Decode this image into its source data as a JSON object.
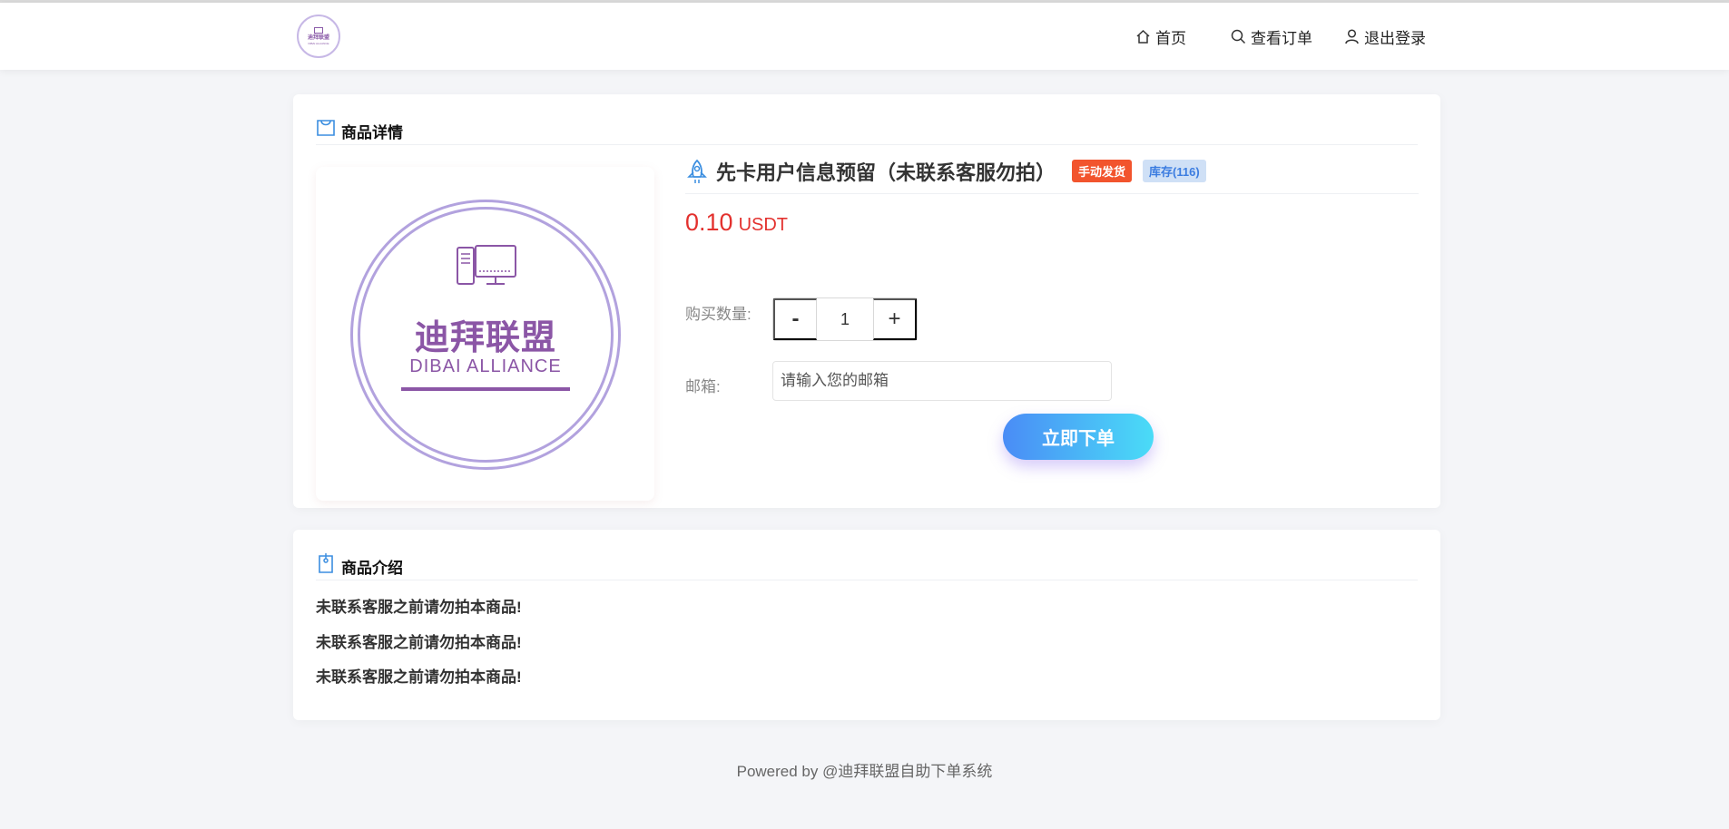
{
  "header": {
    "logo": {
      "text_cn": "迪拜联盟",
      "text_en": "DIBAI ALLIANCE"
    },
    "nav": [
      {
        "label": "首页",
        "icon": "home-icon"
      },
      {
        "label": "查看订单",
        "icon": "search-icon"
      },
      {
        "label": "退出登录",
        "icon": "user-icon"
      }
    ]
  },
  "detail": {
    "section_title": "商品详情",
    "image": {
      "brand_cn": "迪拜联盟",
      "brand_en": "DIBAI ALLIANCE"
    },
    "title": "先卡用户信息预留（未联系客服勿拍）",
    "tag_delivery": "手动发货",
    "tag_stock": "库存(116)",
    "price": "0.10",
    "currency": "USDT",
    "quantity_label": "购买数量:",
    "quantity_minus": "-",
    "quantity_value": "1",
    "quantity_plus": "+",
    "email_label": "邮箱:",
    "email_placeholder": "请输入您的邮箱",
    "order_button": "立即下单"
  },
  "intro": {
    "section_title": "商品介绍",
    "lines": [
      "未联系客服之前请勿拍本商品!",
      "未联系客服之前请勿拍本商品!",
      "未联系客服之前请勿拍本商品!"
    ]
  },
  "footer": {
    "text": "Powered by @迪拜联盟自助下单系统"
  },
  "colors": {
    "price": "#e3312e",
    "brand_purple": "#8b56a6",
    "tag_manual": "#f2542d",
    "tag_stock_bg": "#cfe0f6",
    "button_gradient_start": "#4a8cf6",
    "button_gradient_end": "#4adcf7"
  }
}
